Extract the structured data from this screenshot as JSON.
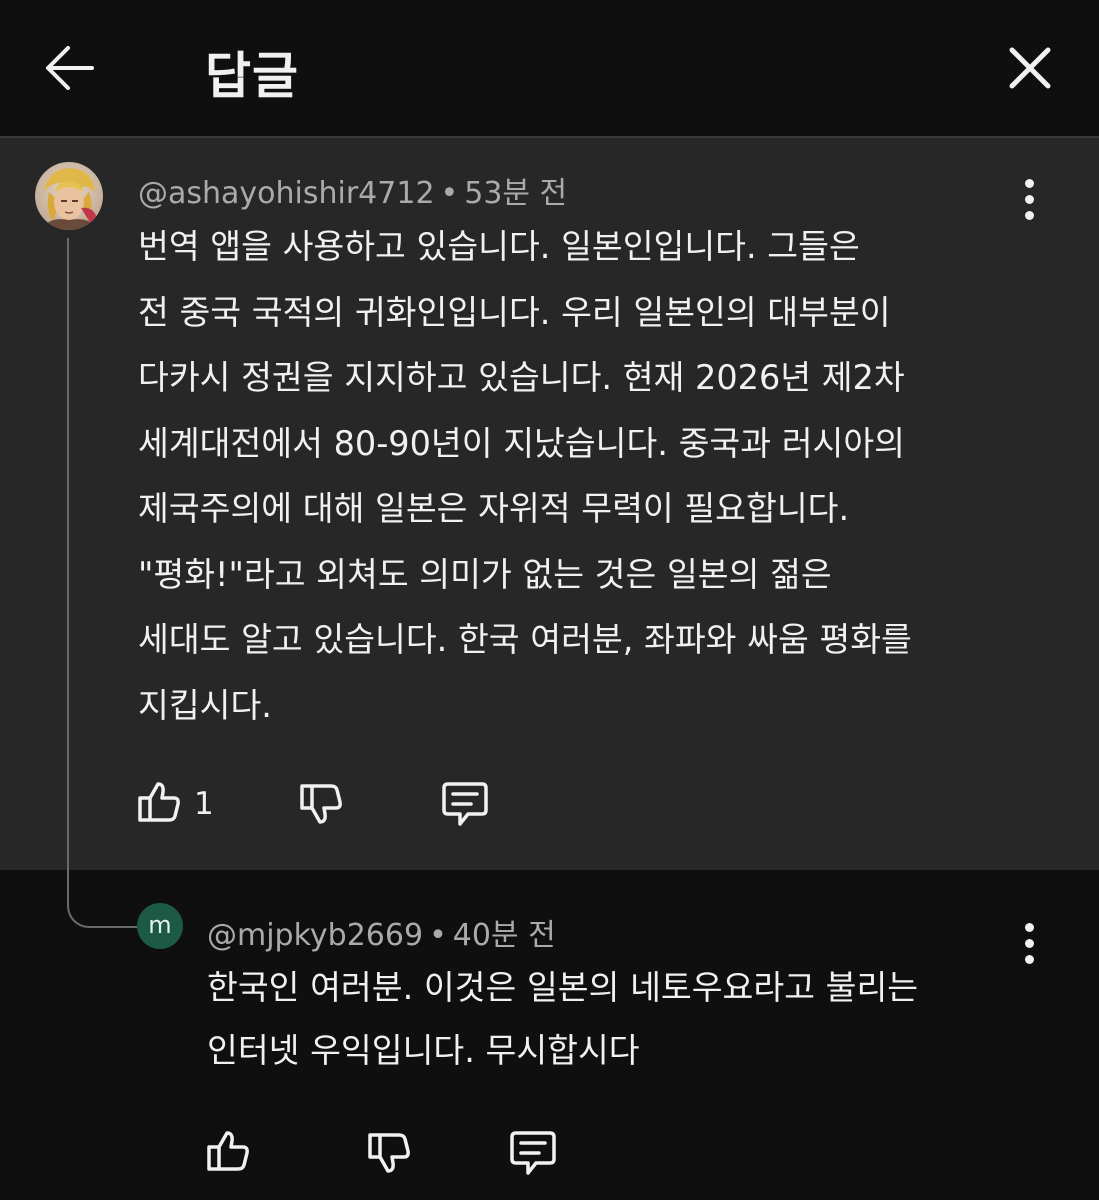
{
  "header": {
    "title": "답글"
  },
  "comments": [
    {
      "author": "@ashayohishir4712",
      "separator": "•",
      "time": "53분 전",
      "lines": [
        "번역 앱을 사용하고 있습니다. 일본인입니다. 그들은",
        "전 중국 국적의 귀화인입니다. 우리 일본인의 대부분이",
        "다카시 정권을 지지하고 있습니다. 현재 2026년 제2차",
        "세계대전에서 80-90년이 지났습니다. 중국과 러시아의",
        "제국주의에 대해 일본은 자위적 무력이 필요합니다.",
        "\"평화!\"라고 외쳐도 의미가 없는 것은 일본의 젊은",
        "세대도 알고 있습니다. 한국 여러분, 좌파와 싸움 평화를",
        "지킵시다."
      ],
      "likes": "1"
    },
    {
      "author": "@mjpkyb2669",
      "avatar_letter": "m",
      "separator": "•",
      "time": "40분 전",
      "lines": [
        "한국인 여러분. 이것은 일본의 네토우요라고 불리는",
        "인터넷 우익입니다. 무시합시다"
      ]
    }
  ],
  "colors": {
    "background": "#0f0f0f",
    "highlight": "#272727",
    "text": "#f1f1f1",
    "secondary_text": "#aaaaaa",
    "avatar_m": "#1d5a45"
  }
}
